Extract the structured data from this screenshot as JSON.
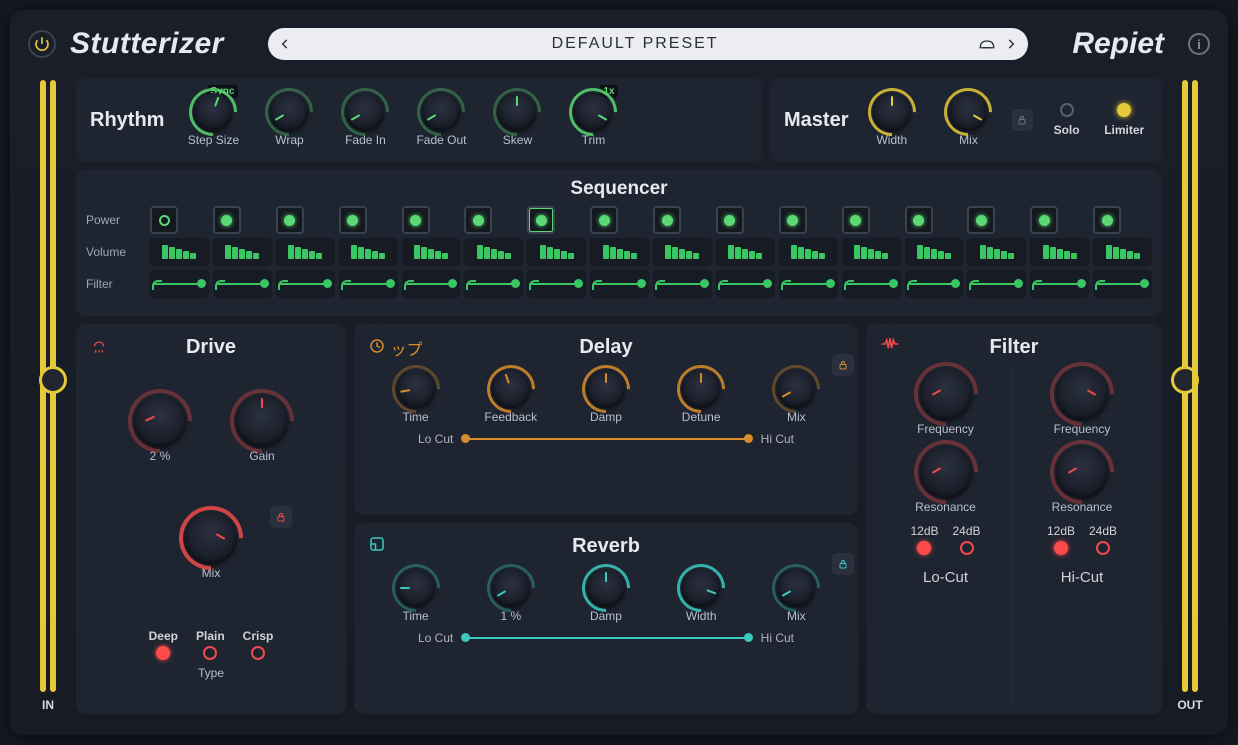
{
  "header": {
    "plugin_name": "Stutterizer",
    "preset_name": "DEFAULT PRESET",
    "brand": "Repiet"
  },
  "meters": {
    "in_label": "IN",
    "out_label": "OUT"
  },
  "rhythm": {
    "title": "Rhythm",
    "sync_badge": "Sync",
    "trim_badge": "1x",
    "knobs": {
      "step_size": "Step Size",
      "wrap": "Wrap",
      "fade_in": "Fade In",
      "fade_out": "Fade Out",
      "skew": "Skew",
      "trim": "Trim"
    }
  },
  "master": {
    "title": "Master",
    "width": "Width",
    "mix": "Mix",
    "solo": "Solo",
    "limiter": "Limiter"
  },
  "sequencer": {
    "title": "Sequencer",
    "rows": {
      "power": "Power",
      "volume": "Volume",
      "filter": "Filter"
    },
    "step_count": 16,
    "first_power_on": false,
    "active_step_index": 7
  },
  "drive": {
    "title": "Drive",
    "pct": "2 %",
    "gain": "Gain",
    "mix": "Mix",
    "type_label": "Type",
    "types": {
      "deep": "Deep",
      "plain": "Plain",
      "crisp": "Crisp"
    }
  },
  "delay": {
    "title": "Delay",
    "time": "Time",
    "feedback": "Feedback",
    "damp": "Damp",
    "detune": "Detune",
    "mix": "Mix",
    "lo": "Lo Cut",
    "hi": "Hi Cut"
  },
  "reverb": {
    "title": "Reverb",
    "time": "Time",
    "pct": "1 %",
    "damp": "Damp",
    "width": "Width",
    "mix": "Mix",
    "lo": "Lo Cut",
    "hi": "Hi Cut"
  },
  "filter": {
    "title": "Filter",
    "frequency": "Frequency",
    "resonance": "Resonance",
    "db12": "12dB",
    "db24": "24dB",
    "locut": "Lo-Cut",
    "hicut": "Hi-Cut"
  },
  "colors": {
    "green": "#5bd873",
    "yellow": "#e4c93a",
    "orange": "#d98c2b",
    "teal": "#3bc9c0",
    "red": "#f04a4a"
  }
}
